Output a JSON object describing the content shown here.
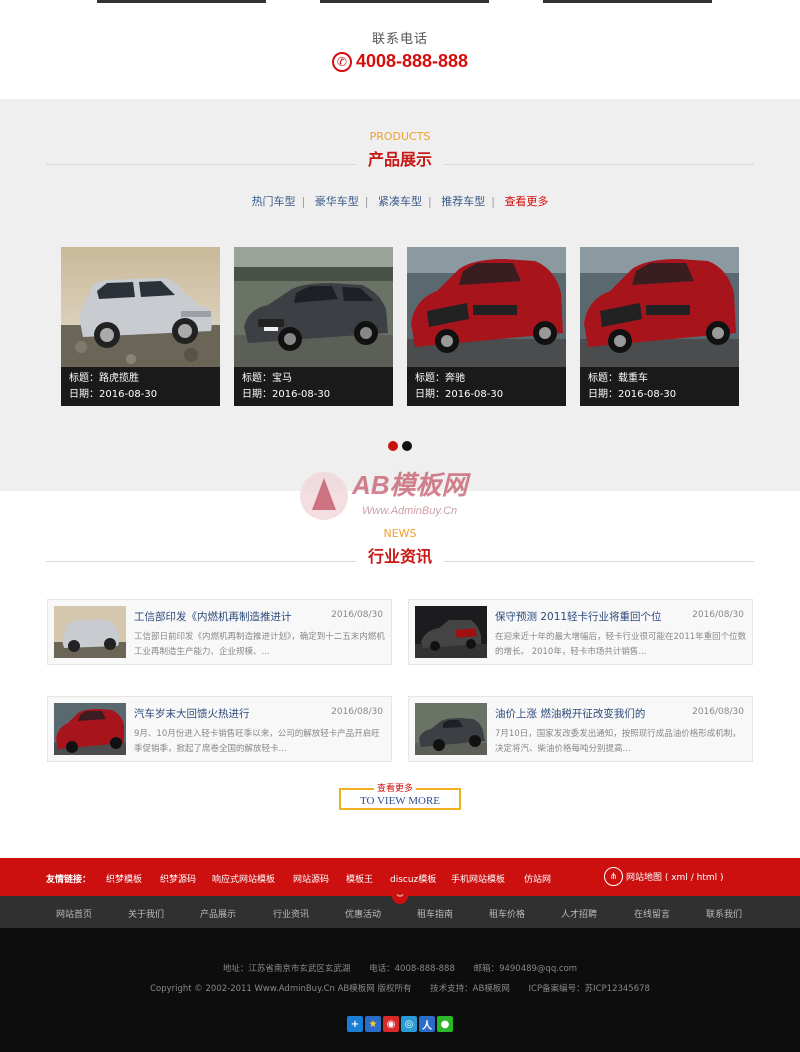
{
  "contact": {
    "label": "联系电话",
    "phone": "4008-888-888"
  },
  "products": {
    "en": "PRODUCTS",
    "cn": "产品展示",
    "categories": [
      "热门车型",
      "豪华车型",
      "紧凑车型",
      "推荐车型"
    ],
    "more": "查看更多",
    "items": [
      {
        "title": "标题：路虎揽胜",
        "date": "日期：2016-08-30"
      },
      {
        "title": "标题：宝马",
        "date": "日期：2016-08-30"
      },
      {
        "title": "标题：奔驰",
        "date": "日期：2016-08-30"
      },
      {
        "title": "标题：载重车",
        "date": "日期：2016-08-30"
      }
    ]
  },
  "watermark": {
    "brand": "AB模板网",
    "url": "Www.AdminBuy.Cn"
  },
  "news": {
    "en": "NEWS",
    "cn": "行业资讯",
    "items": [
      {
        "title": "工信部印发《内燃机再制造推进计",
        "date": "2016/08/30",
        "desc": "工信部日前印发《内燃机再制造推进计划》，确定到十二五末内燃机工业再制造生产能力、企业规模、..."
      },
      {
        "title": "保守预测 2011轻卡行业将重回个位",
        "date": "2016/08/30",
        "desc": "在迎来近十年的最大增幅后，轻卡行业很可能在2011年重回个位数的增长。 2010年，轻卡市场共计销售..."
      },
      {
        "title": "汽车岁末大回馈火热进行",
        "date": "2016/08/30",
        "desc": "9月、10月份进入轻卡销售旺季以来，公司的解放轻卡产品开启旺季促销季，掀起了席卷全国的解放轻卡..."
      },
      {
        "title": "油价上涨 燃油税开征改变我们的",
        "date": "2016/08/30",
        "desc": "7月10日，国家发改委发出通知，按照现行成品油价格形成机制，决定将汽、柴油价格每吨分别提高..."
      }
    ],
    "view_more_cn": "查看更多",
    "view_more_en": "TO VIEW MORE"
  },
  "links": {
    "label": "友情链接：",
    "items": [
      "织梦模板",
      "织梦源码",
      "响应式网站模板",
      "网站源码",
      "模板王",
      "discuz模板",
      "手机网站模板",
      "仿站网"
    ],
    "sitemap": "网站地图 ( xml / html )"
  },
  "nav": [
    "网站首页",
    "关于我们",
    "产品展示",
    "行业资讯",
    "优惠活动",
    "租车指南",
    "租车价格",
    "人才招聘",
    "在线留言",
    "联系我们"
  ],
  "footer": {
    "address": "地址：江苏省南京市玄武区玄武湖",
    "phone": "电话：4008-888-888",
    "email": "邮箱：9490489@qq.com",
    "copyright": "Copyright © 2002-2011 Www.AdminBuy.Cn AB模板网 版权所有",
    "support": "技术支持：AB模板网",
    "icp": "ICP备案编号：苏ICP12345678"
  },
  "colors": {
    "accent_red": "#cc1010",
    "orange": "#f0a030",
    "link_blue": "#2b4a7a"
  }
}
